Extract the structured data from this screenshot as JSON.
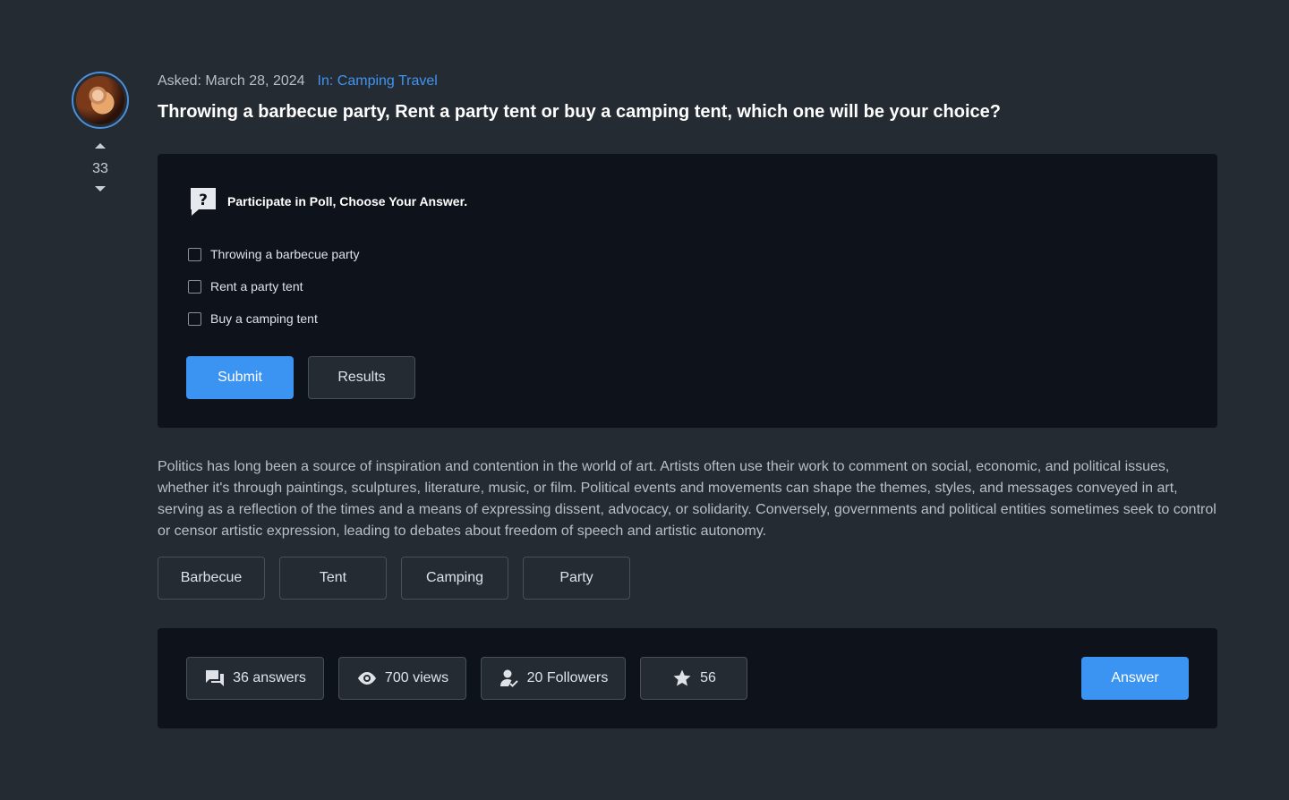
{
  "vote": {
    "count": "33"
  },
  "header": {
    "asked": "Asked: March 28, 2024",
    "category": "In: Camping Travel",
    "title": "Throwing a barbecue party, Rent a party tent or buy a camping tent, which one will be your choice?"
  },
  "poll": {
    "heading": "Participate in Poll, Choose Your Answer.",
    "options": [
      "Throwing a barbecue party",
      "Rent a party tent",
      "Buy a camping tent"
    ],
    "submit_label": "Submit",
    "results_label": "Results"
  },
  "description": "Politics has long been a source of inspiration and contention in the world of art. Artists often use their work to comment on social, economic, and political issues, whether it's through paintings, sculptures, literature, music, or film. Political events and movements can shape the themes, styles, and messages conveyed in art, serving as a reflection of the times and a means of expressing dissent, advocacy, or solidarity. Conversely, governments and political entities sometimes seek to control or censor artistic expression, leading to debates about freedom of speech and artistic autonomy.",
  "tags": [
    "Barbecue",
    "Tent",
    "Camping",
    "Party"
  ],
  "stats": {
    "answers": "36 answers",
    "views": "700 views",
    "followers": "20 Followers",
    "stars": "56",
    "answer_label": "Answer"
  },
  "icons": {
    "answers": "chat-bubbles-icon",
    "views": "eye-icon",
    "followers": "user-check-icon",
    "stars": "star-icon",
    "poll": "question-bubble-icon"
  },
  "colors": {
    "accent": "#3b94f2",
    "background": "#252b33",
    "card": "#0e121a",
    "link": "#3f95f2"
  }
}
